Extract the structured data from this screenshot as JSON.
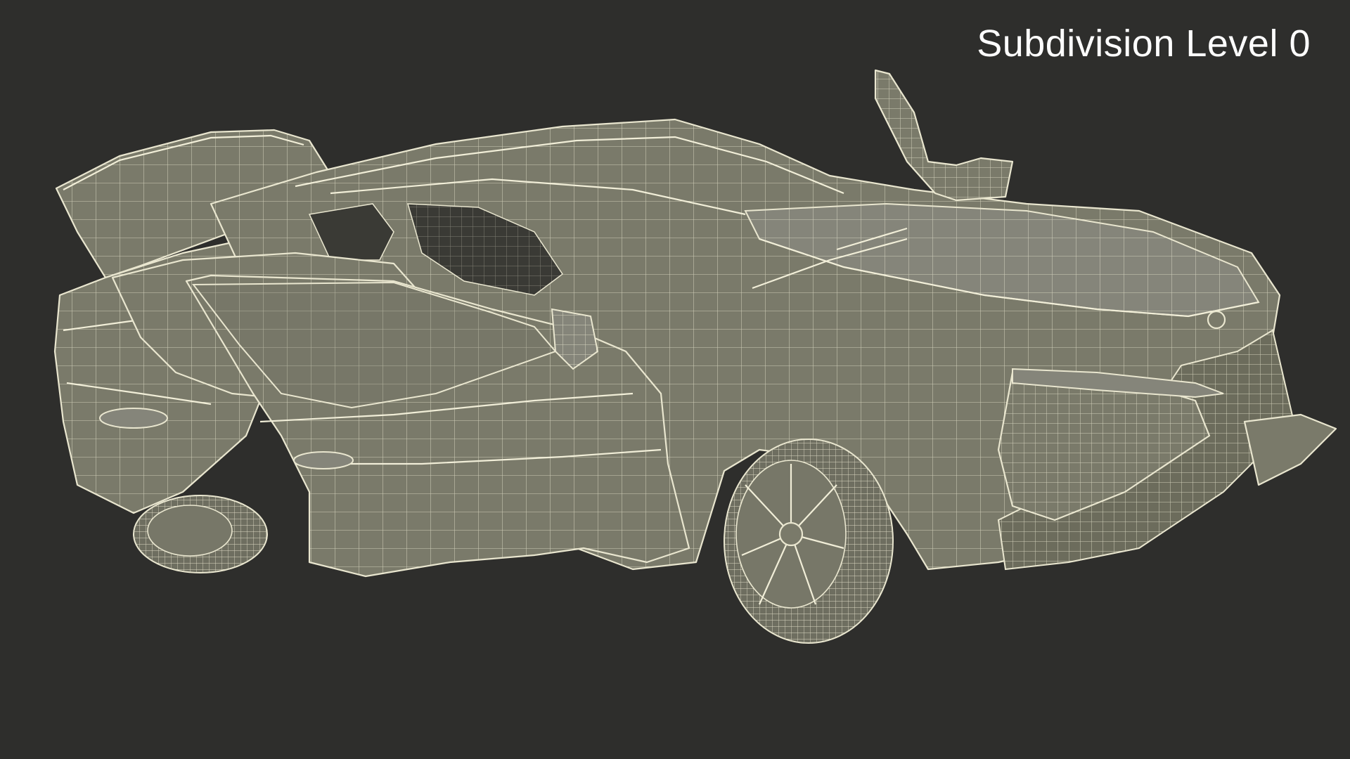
{
  "overlay": {
    "label": "Subdivision Level 0"
  },
  "scene": {
    "background_color": "#2e2e2c",
    "mesh_fill_color": "#7a7a6a",
    "wire_color": "#e9e6cf"
  }
}
